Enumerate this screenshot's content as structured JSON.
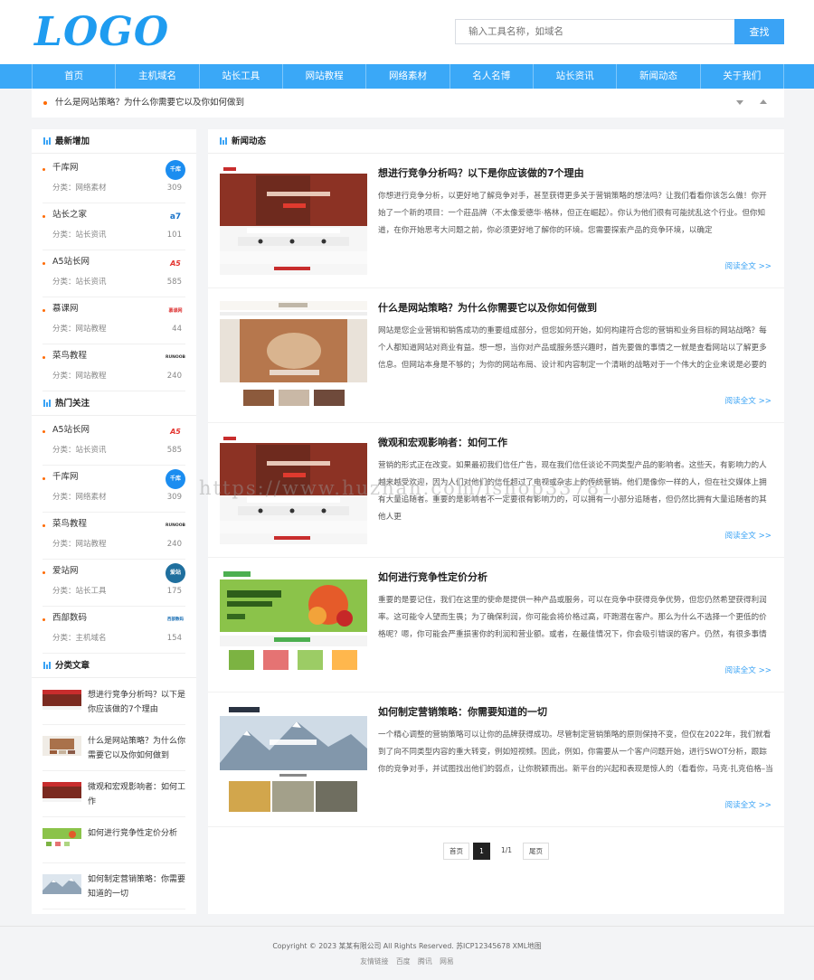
{
  "header": {
    "logo": "LOGO",
    "search_placeholder": "输入工具名称，如域名",
    "search_button": "查找",
    "colors": {
      "brand": "#1f9cf0",
      "nav": "#3aa8f7",
      "accent": "#ff6a00"
    }
  },
  "nav": [
    "首页",
    "主机域名",
    "站长工具",
    "网站教程",
    "网络素材",
    "名人名博",
    "站长资讯",
    "新闻动态",
    "关于我们"
  ],
  "ticker": {
    "text": "什么是网站策略？为什么你需要它以及你如何做到",
    "icons": [
      "chevron-down-icon",
      "chevron-up-icon"
    ]
  },
  "sidebar": {
    "latest": {
      "title": "最新增加",
      "items": [
        {
          "name": "千库网",
          "cat": "分类：网络素材",
          "num": "309",
          "logo": "千库"
        },
        {
          "name": "站长之家",
          "cat": "分类：站长资讯",
          "num": "101",
          "logo": "a7"
        },
        {
          "name": "A5站长网",
          "cat": "分类：站长资讯",
          "num": "585",
          "logo": "A5"
        },
        {
          "name": "慕课网",
          "cat": "分类：网站教程",
          "num": "44",
          "logo": "慕课网"
        },
        {
          "name": "菜鸟教程",
          "cat": "分类：网站教程",
          "num": "240",
          "logo": "RUNOOB"
        }
      ]
    },
    "hot": {
      "title": "热门关注",
      "items": [
        {
          "name": "A5站长网",
          "cat": "分类：站长资讯",
          "num": "585",
          "logo": "A5"
        },
        {
          "name": "千库网",
          "cat": "分类：网络素材",
          "num": "309",
          "logo": "千库"
        },
        {
          "name": "菜鸟教程",
          "cat": "分类：网站教程",
          "num": "240",
          "logo": "RUNOOB"
        },
        {
          "name": "爱站网",
          "cat": "分类：站长工具",
          "num": "175",
          "logo": "爱站"
        },
        {
          "name": "西部数码",
          "cat": "分类：主机域名",
          "num": "154",
          "logo": "西部数码"
        }
      ]
    },
    "category": {
      "title": "分类文章",
      "items": [
        {
          "text": "想进行竞争分析吗？以下是你应该做的7个理由"
        },
        {
          "text": "什么是网站策略？为什么你需要它以及你如何做到"
        },
        {
          "text": "微观和宏观影响者：如何工作"
        },
        {
          "text": "如何进行竞争性定价分析"
        },
        {
          "text": "如何制定营销策略：你需要知道的一切"
        }
      ]
    }
  },
  "main": {
    "title": "新闻动态",
    "more_label": "阅读全文 >>",
    "articles": [
      {
        "title": "想进行竞争分析吗？以下是你应该做的7个理由",
        "summary": "你想进行竞争分析，以更好地了解竞争对手，甚至获得更多关于营销策略的想法吗？让我们看看你该怎么做！你开始了一个新的项目：一个莊品牌（不太像爱德华·格林，但正在崛起）。你认为他们很有可能扰乱这个行业。但你知道，在你开始思考大问题之前，你必须更好地了解你的环境。您需要探索产品的竞争环境，以确定",
        "thumb_caption": "Cosme Web Development"
      },
      {
        "title": "什么是网站策略？为什么你需要它以及你如何做到",
        "summary": "网站是您企业营销和销售成功的重要组成部分，但您如何开始，如何构建符合您的营销和业务目标的网站战略？每个人都知道网站对商业有益。想一想，当你对产品或服务感兴趣时，首先要做的事情之一就是查看网站以了解更多信息。但网站本身是不够的；为你的网站布局、设计和内容制定一个清晰的战略对于一个伟大的企业来说是必要的",
        "thumb_caption": "Fashion Store"
      },
      {
        "title": "微观和宏观影响者：如何工作",
        "summary": "营销的形式正在改变。如果最初我们信任广告，现在我们信任谈论不同类型产品的影响者。这些天，有影响力的人越来越受欢迎，因为人们对他们的信任超过了电视或杂志上的传统营销。他们是像你一样的人，但在社交媒体上拥有大量追随者。重要的是影响者不一定要很有影响力的，可以拥有一小部分追随者，但仍然比拥有大量追随者的其他人更",
        "thumb_caption": "Cosme Web Development"
      },
      {
        "title": "如何进行竞争性定价分析",
        "summary": "重要的是要记住，我们在这里的使命是提供一种产品或服务，可以在竞争中获得竞争优势，但您仍然希望获得利润率。这可能令人望而生畏；为了确保利润，你可能会将价格过高，吓跑潜在客户。那么为什么不选择一个更低的价格呢？嗯，你可能会严重损害你的利润和营业额。或者，在最佳情况下，你会吸引错误的客户。仍然，有很多事情",
        "thumb_caption": "Organic Farm"
      },
      {
        "title": "如何制定营销策略：你需要知道的一切",
        "summary": "一个精心调整的营销策略可以让你的品牌获得成功。尽管制定营销策略的原则保持不变，但仅在2022年，我们就看到了向不同类型内容的重大转变，例如短视频。因此，例如，你需要从一个客户问题开始，进行SWOT分析，跟踪你的竞争对手，并试图找出他们的弱点，让你脱颖而出。新平台的兴起和表现是惊人的（看看你，马克·扎克伯格–当",
        "thumb_caption": "VIRTUE"
      }
    ],
    "pager": [
      "首页",
      "1",
      "1/1",
      "尾页"
    ]
  },
  "footer": {
    "copyright": "Copyright © 2023 某某有限公司 All Rights Reserved. 苏ICP12345678 XML地图",
    "links_label": "友情链接",
    "links": [
      "百度",
      "腾讯",
      "网易"
    ]
  },
  "watermark": "https://www.huzhan.com/ishop33781"
}
